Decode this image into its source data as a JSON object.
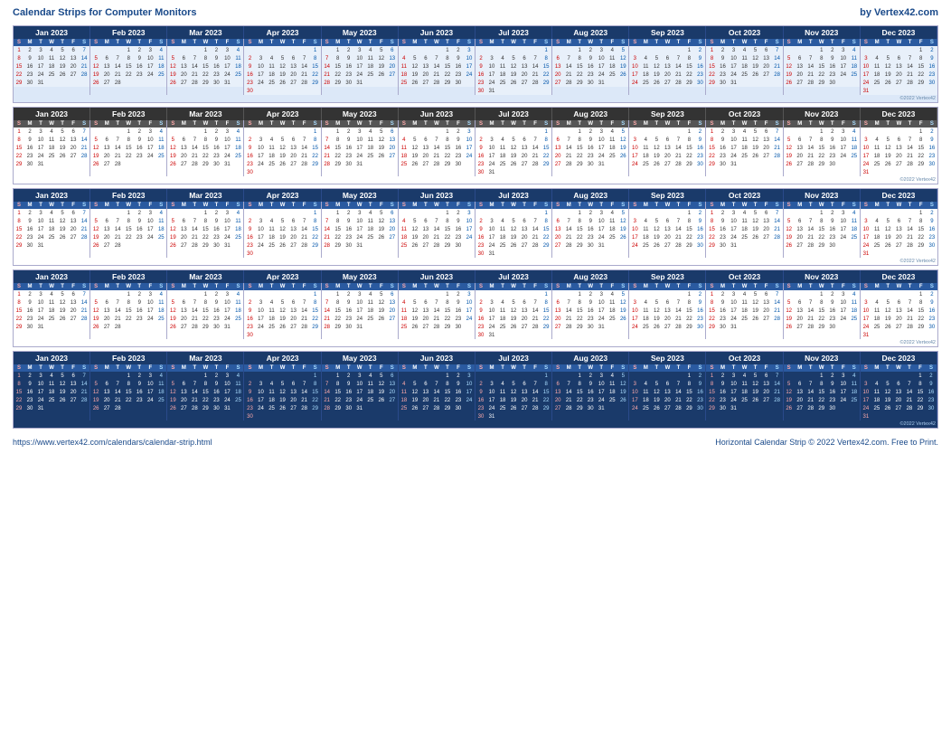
{
  "header": {
    "title": "Calendar Strips for Computer Monitors",
    "brand": "by Vertex42.com"
  },
  "footer": {
    "url": "https://www.vertex42.com/calendars/calendar-strip.html",
    "copyright": "Horizontal Calendar Strip © 2022 Vertex42.com. Free to Print."
  },
  "months": [
    {
      "name": "Jan 2023",
      "start": 0,
      "days": 31
    },
    {
      "name": "Feb 2023",
      "start": 2,
      "days": 28
    },
    {
      "name": "Mar 2023",
      "start": 2,
      "days": 31
    },
    {
      "name": "Apr 2023",
      "start": 5,
      "days": 30
    },
    {
      "name": "May 2023",
      "start": 0,
      "days": 31
    },
    {
      "name": "Jun 2023",
      "start": 3,
      "days": 30
    },
    {
      "name": "Jul 2023",
      "start": 5,
      "days": 31
    },
    {
      "name": "Aug 2023",
      "start": 1,
      "days": 31
    },
    {
      "name": "Sep 2023",
      "start": 4,
      "days": 30
    },
    {
      "name": "Oct 2023",
      "start": 0,
      "days": 31
    },
    {
      "name": "Nov 2023",
      "start": 3,
      "days": 30
    },
    {
      "name": "Dec 2023",
      "start": 5,
      "days": 31
    }
  ],
  "dayLabels": [
    "S",
    "M",
    "T",
    "W",
    "T",
    "F",
    "S"
  ],
  "watermark": "Vertex42.com",
  "copyrightNote": "©2022 Vertex42"
}
